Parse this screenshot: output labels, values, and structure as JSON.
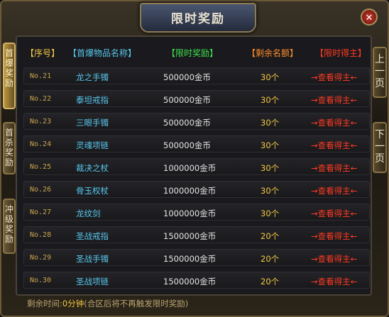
{
  "title": "限时奖励",
  "close_label": "ⓧ",
  "side_tabs": [
    "首爆奖励",
    "首杀奖励",
    "冲级奖励"
  ],
  "page_buttons": {
    "prev": "上一页",
    "next": "下一页"
  },
  "columns": {
    "index": "【序号】",
    "item_name": "【首爆物品名称】",
    "reward": "【限时奖励】",
    "remaining": "【剩余名额】",
    "winner": "【限时得主】"
  },
  "rows": [
    {
      "no": "No.21",
      "name": "龙之手镯",
      "reward": "500000金币",
      "remaining": "30个",
      "action": "→查看得主←"
    },
    {
      "no": "No.22",
      "name": "泰坦戒指",
      "reward": "500000金币",
      "remaining": "30个",
      "action": "→查看得主←"
    },
    {
      "no": "No.23",
      "name": "三眼手镯",
      "reward": "500000金币",
      "remaining": "30个",
      "action": "→查看得主←"
    },
    {
      "no": "No.24",
      "name": "灵魂项链",
      "reward": "500000金币",
      "remaining": "30个",
      "action": "→查看得主←"
    },
    {
      "no": "No.25",
      "name": "裁决之杖",
      "reward": "1000000金币",
      "remaining": "30个",
      "action": "→查看得主←"
    },
    {
      "no": "No.26",
      "name": "骨玉权杖",
      "reward": "1000000金币",
      "remaining": "30个",
      "action": "→查看得主←"
    },
    {
      "no": "No.27",
      "name": "龙纹剑",
      "reward": "1000000金币",
      "remaining": "30个",
      "action": "→查看得主←"
    },
    {
      "no": "No.28",
      "name": "圣战戒指",
      "reward": "1500000金币",
      "remaining": "20个",
      "action": "→查看得主←"
    },
    {
      "no": "No.29",
      "name": "圣战手镯",
      "reward": "1500000金币",
      "remaining": "20个",
      "action": "→查看得主←"
    },
    {
      "no": "No.30",
      "name": "圣战项链",
      "reward": "1500000金币",
      "remaining": "20个",
      "action": "→查看得主←"
    }
  ],
  "footer": {
    "label": "剩余时间:",
    "value": "0分钟",
    "note": "(合区后将不再触发限时奖励)"
  },
  "colors": {
    "index_header": "#f2c744",
    "name_header": "#57c7ec",
    "reward_header": "#3ee04b",
    "remaining_header": "#ff8c2a",
    "winner_header": "#ff3a22"
  }
}
